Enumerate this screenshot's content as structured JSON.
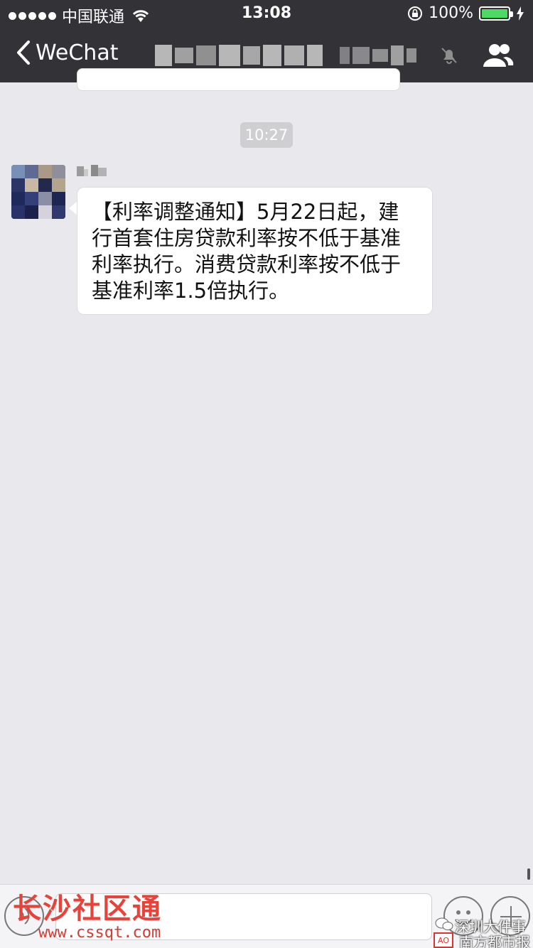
{
  "status_bar": {
    "carrier": "中国联通",
    "time": "13:08",
    "battery": "100%"
  },
  "nav": {
    "back_label": "WeChat",
    "title_redacted": true
  },
  "chat": {
    "timestamp": "10:27",
    "message": "【利率调整通知】5月22日起，建行首套住房贷款利率按不低于基准利率执行。消费贷款利率按不低于基准利率1.5倍执行。"
  },
  "watermarks": {
    "left_title": "长沙社区通",
    "left_url": "www.cssqt.com",
    "right_line1": "深圳大件事",
    "right_line2": "南方都市报"
  },
  "colors": {
    "header_bg": "#333236",
    "chat_bg": "#e9e8ec",
    "battery_green": "#4cd964",
    "watermark_red": "#e8433a"
  }
}
